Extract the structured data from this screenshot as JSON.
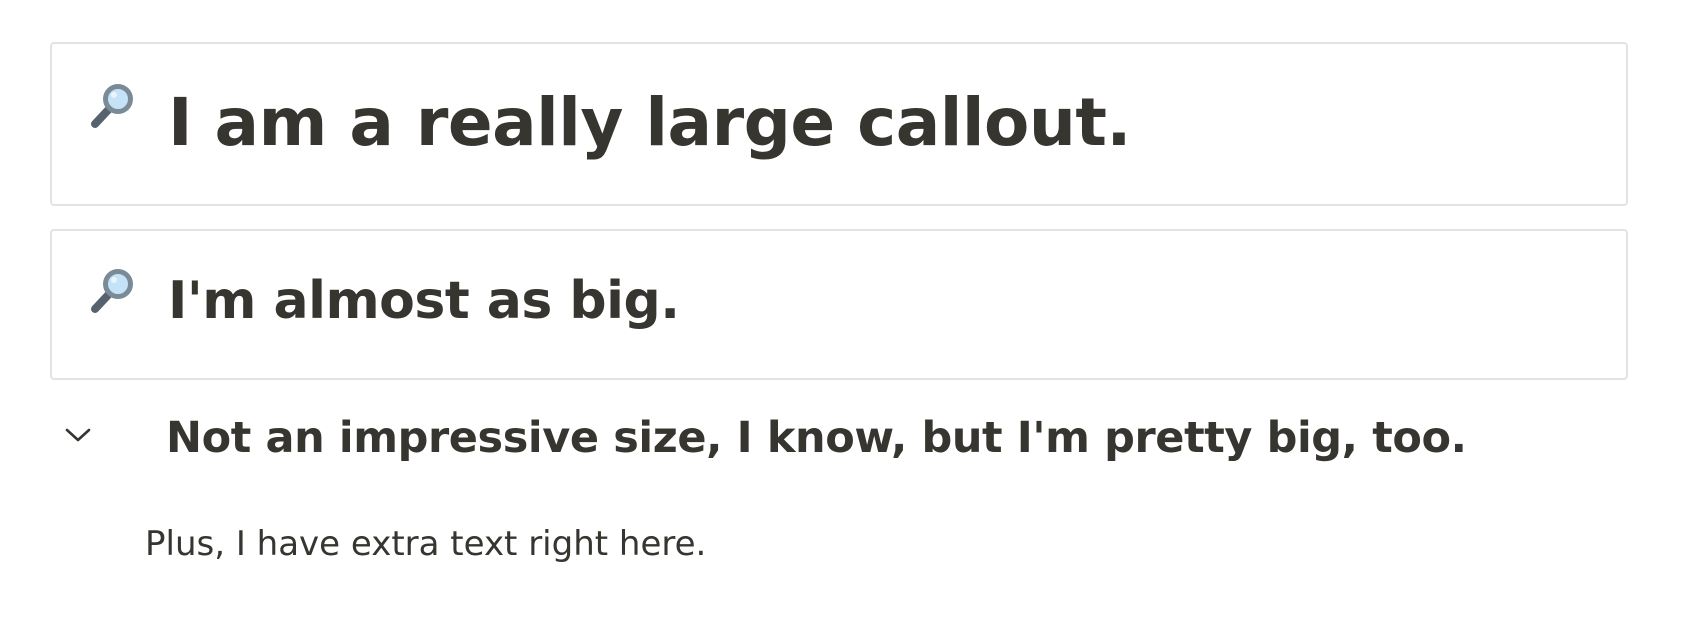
{
  "callouts": [
    {
      "icon": "magnifying-glass-icon",
      "text": "I am a really large callout."
    },
    {
      "icon": "magnifying-glass-icon",
      "text": "I'm almost as big."
    }
  ],
  "toggle": {
    "icon": "chevron-down-icon",
    "heading": "Not an impressive size, I know, but I'm pretty big, too.",
    "body": "Plus, I have extra text right here."
  },
  "colors": {
    "text": "#37352f",
    "border": "#e3e3e1",
    "icon_lens": "#c4e3f7",
    "icon_frame": "#7b8a97"
  }
}
